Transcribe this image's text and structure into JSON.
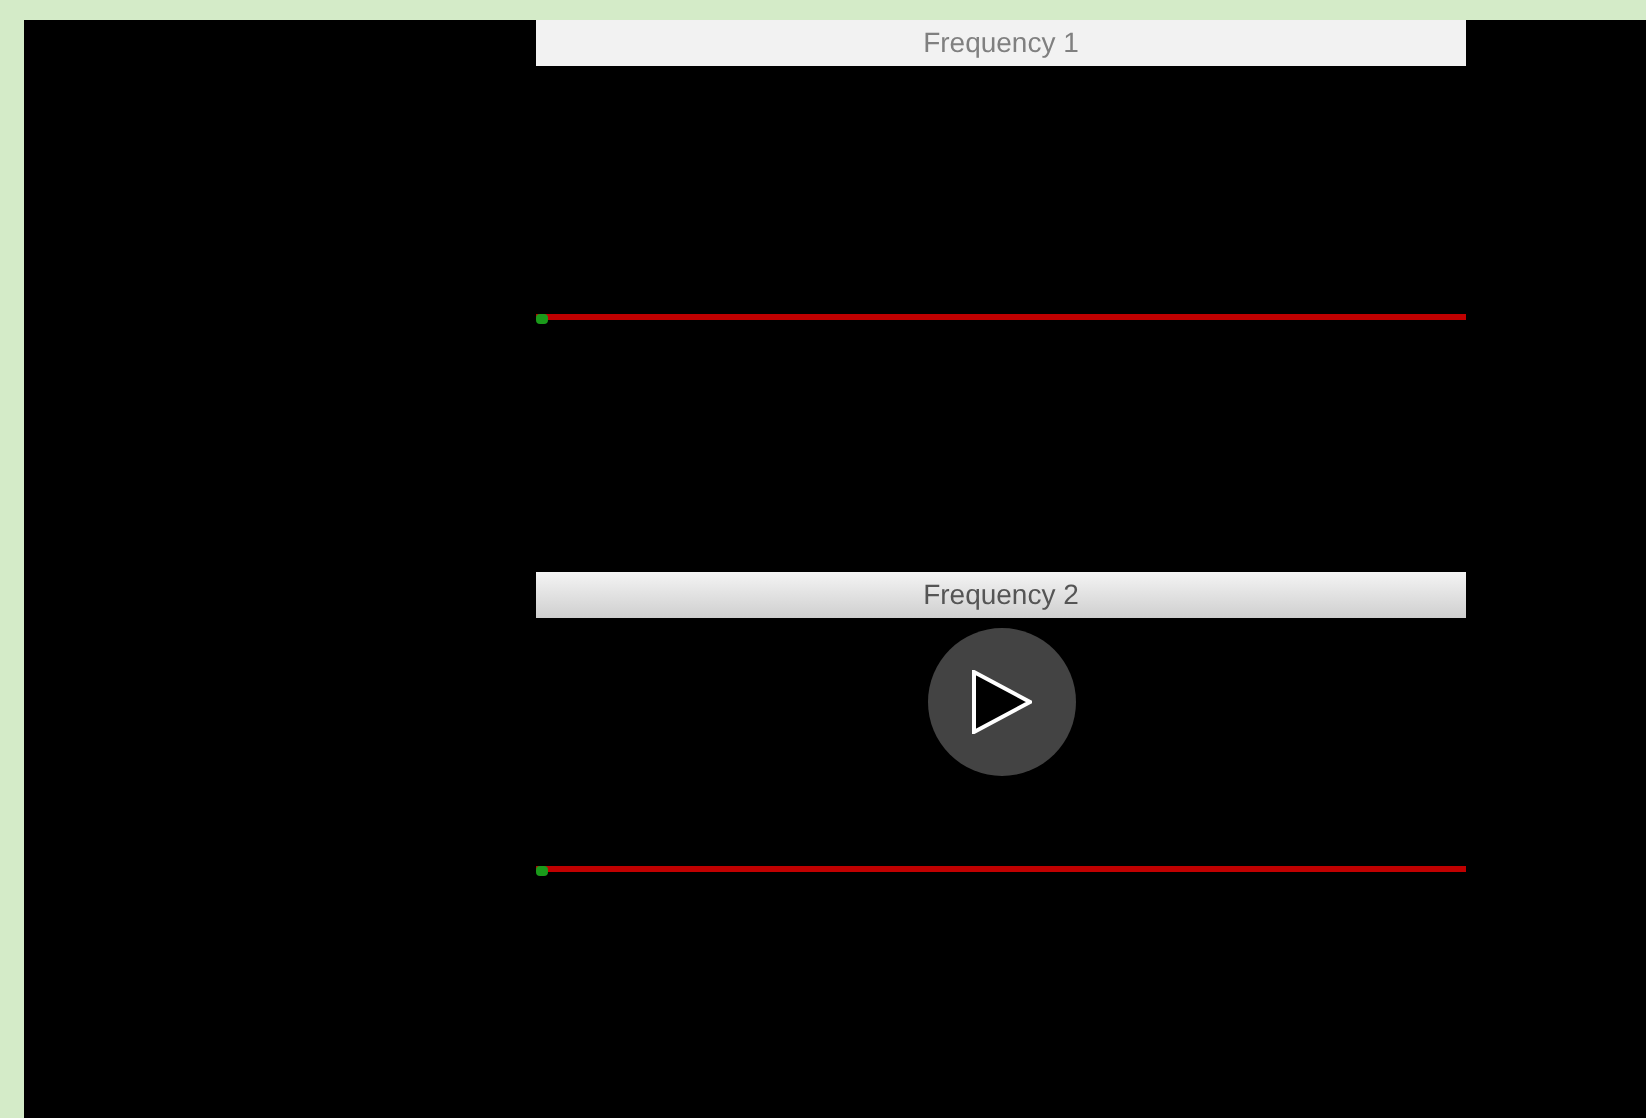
{
  "panels": [
    {
      "title": "Frequency 1",
      "active": false,
      "level": 0.01
    },
    {
      "title": "Frequency 2",
      "active": true,
      "level": 0.01
    }
  ]
}
